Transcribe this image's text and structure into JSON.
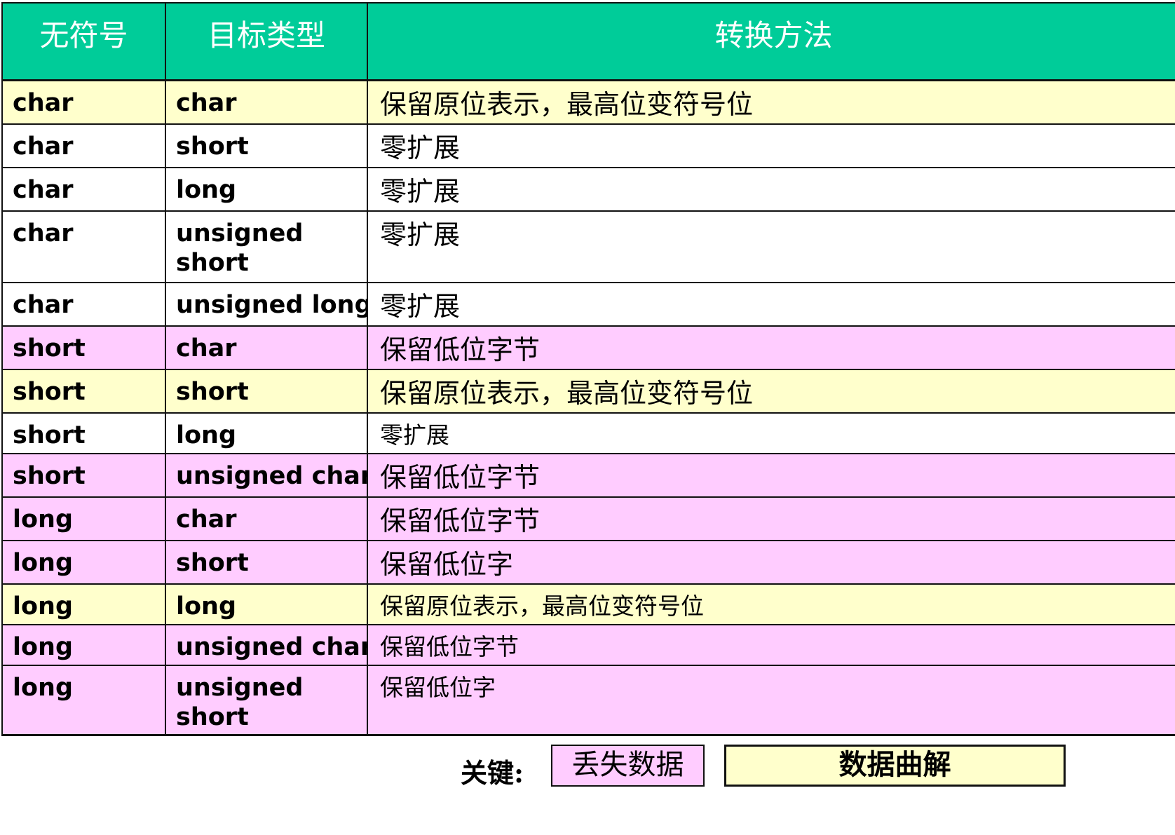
{
  "table": {
    "headers": [
      "无符号",
      "目标类型",
      "转换方法"
    ],
    "header_color": "#00cc99",
    "row_colors": {
      "yellow": "#ffffcc",
      "white": "#ffffff",
      "pink": "#ffccff"
    },
    "rows": [
      {
        "src": "char",
        "dst": "char",
        "method": "保留原位表示，最高位变符号位",
        "color": "yellow"
      },
      {
        "src": "char",
        "dst": "short",
        "method": "零扩展",
        "color": "white"
      },
      {
        "src": "char",
        "dst": "long",
        "method": "零扩展",
        "color": "white"
      },
      {
        "src": "char",
        "dst": "unsigned short",
        "method": "零扩展",
        "color": "white"
      },
      {
        "src": "char",
        "dst": "unsigned long",
        "method": "零扩展",
        "color": "white"
      },
      {
        "src": "short",
        "dst": "char",
        "method": "保留低位字节",
        "color": "pink"
      },
      {
        "src": "short",
        "dst": "short",
        "method": "保留原位表示，最高位变符号位",
        "color": "yellow"
      },
      {
        "src": "short",
        "dst": "long",
        "method": "零扩展",
        "color": "white"
      },
      {
        "src": "short",
        "dst": "unsigned char",
        "method": "保留低位字节",
        "color": "pink"
      },
      {
        "src": "long",
        "dst": "char",
        "method": "保留低位字节",
        "color": "pink"
      },
      {
        "src": "long",
        "dst": "short",
        "method": "保留低位字",
        "color": "pink"
      },
      {
        "src": "long",
        "dst": "long",
        "method": "保留原位表示，最高位变符号位",
        "color": "yellow"
      },
      {
        "src": "long",
        "dst": "unsigned char",
        "method": "保留低位字节",
        "color": "pink"
      },
      {
        "src": "long",
        "dst": "unsigned short",
        "method": "保留低位字",
        "color": "pink"
      }
    ]
  },
  "legend": {
    "key_label": "关键:",
    "lost_data": "丢失数据",
    "misinterpreted_data": "数据曲解"
  }
}
